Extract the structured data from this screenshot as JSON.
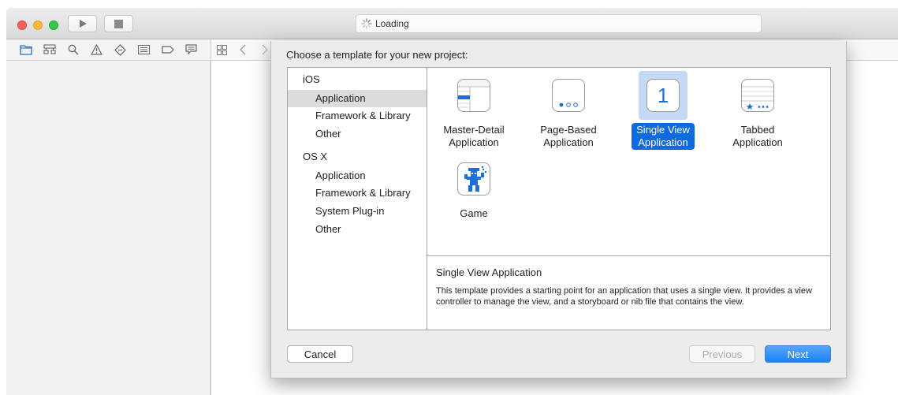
{
  "window": {
    "activity_text": "Loading"
  },
  "toolbar": {
    "run_icon": "play-icon",
    "stop_icon": "stop-icon"
  },
  "navigator": {
    "icons": [
      "folder-icon",
      "hierarchy-icon",
      "search-icon",
      "warning-icon",
      "test-diamond-icon",
      "list-icon",
      "breakpoint-tag-icon",
      "comment-icon"
    ]
  },
  "jumpbar": {
    "icons": [
      "grid-icon",
      "chevron-left-icon",
      "chevron-right-icon"
    ]
  },
  "sheet": {
    "title": "Choose a template for your new project:",
    "categories": [
      {
        "group": "iOS",
        "items": [
          "Application",
          "Framework & Library",
          "Other"
        ]
      },
      {
        "group": "OS X",
        "items": [
          "Application",
          "Framework & Library",
          "System Plug-in",
          "Other"
        ]
      }
    ],
    "selected_category": "iOS / Application",
    "templates": [
      {
        "line1": "Master-Detail",
        "line2": "Application",
        "icon": "master-detail-icon"
      },
      {
        "line1": "Page-Based",
        "line2": "Application",
        "icon": "page-based-icon"
      },
      {
        "line1": "Single View",
        "line2": "Application",
        "icon": "single-view-icon",
        "icon_text": "1",
        "selected": true
      },
      {
        "line1": "Tabbed",
        "line2": "Application",
        "icon": "tabbed-icon"
      },
      {
        "line1": "Game",
        "line2": "",
        "icon": "game-icon"
      }
    ],
    "description": {
      "title": "Single View Application",
      "text": "This template provides a starting point for an application that uses a single view. It provides a view controller to manage the view, and a storyboard or nib file that contains the view."
    },
    "buttons": {
      "cancel": "Cancel",
      "previous": "Previous",
      "next": "Next"
    }
  },
  "colors": {
    "accent": "#1a82f7",
    "selection": "#0f6ae0",
    "icon_blue": "#1d6fd8"
  }
}
